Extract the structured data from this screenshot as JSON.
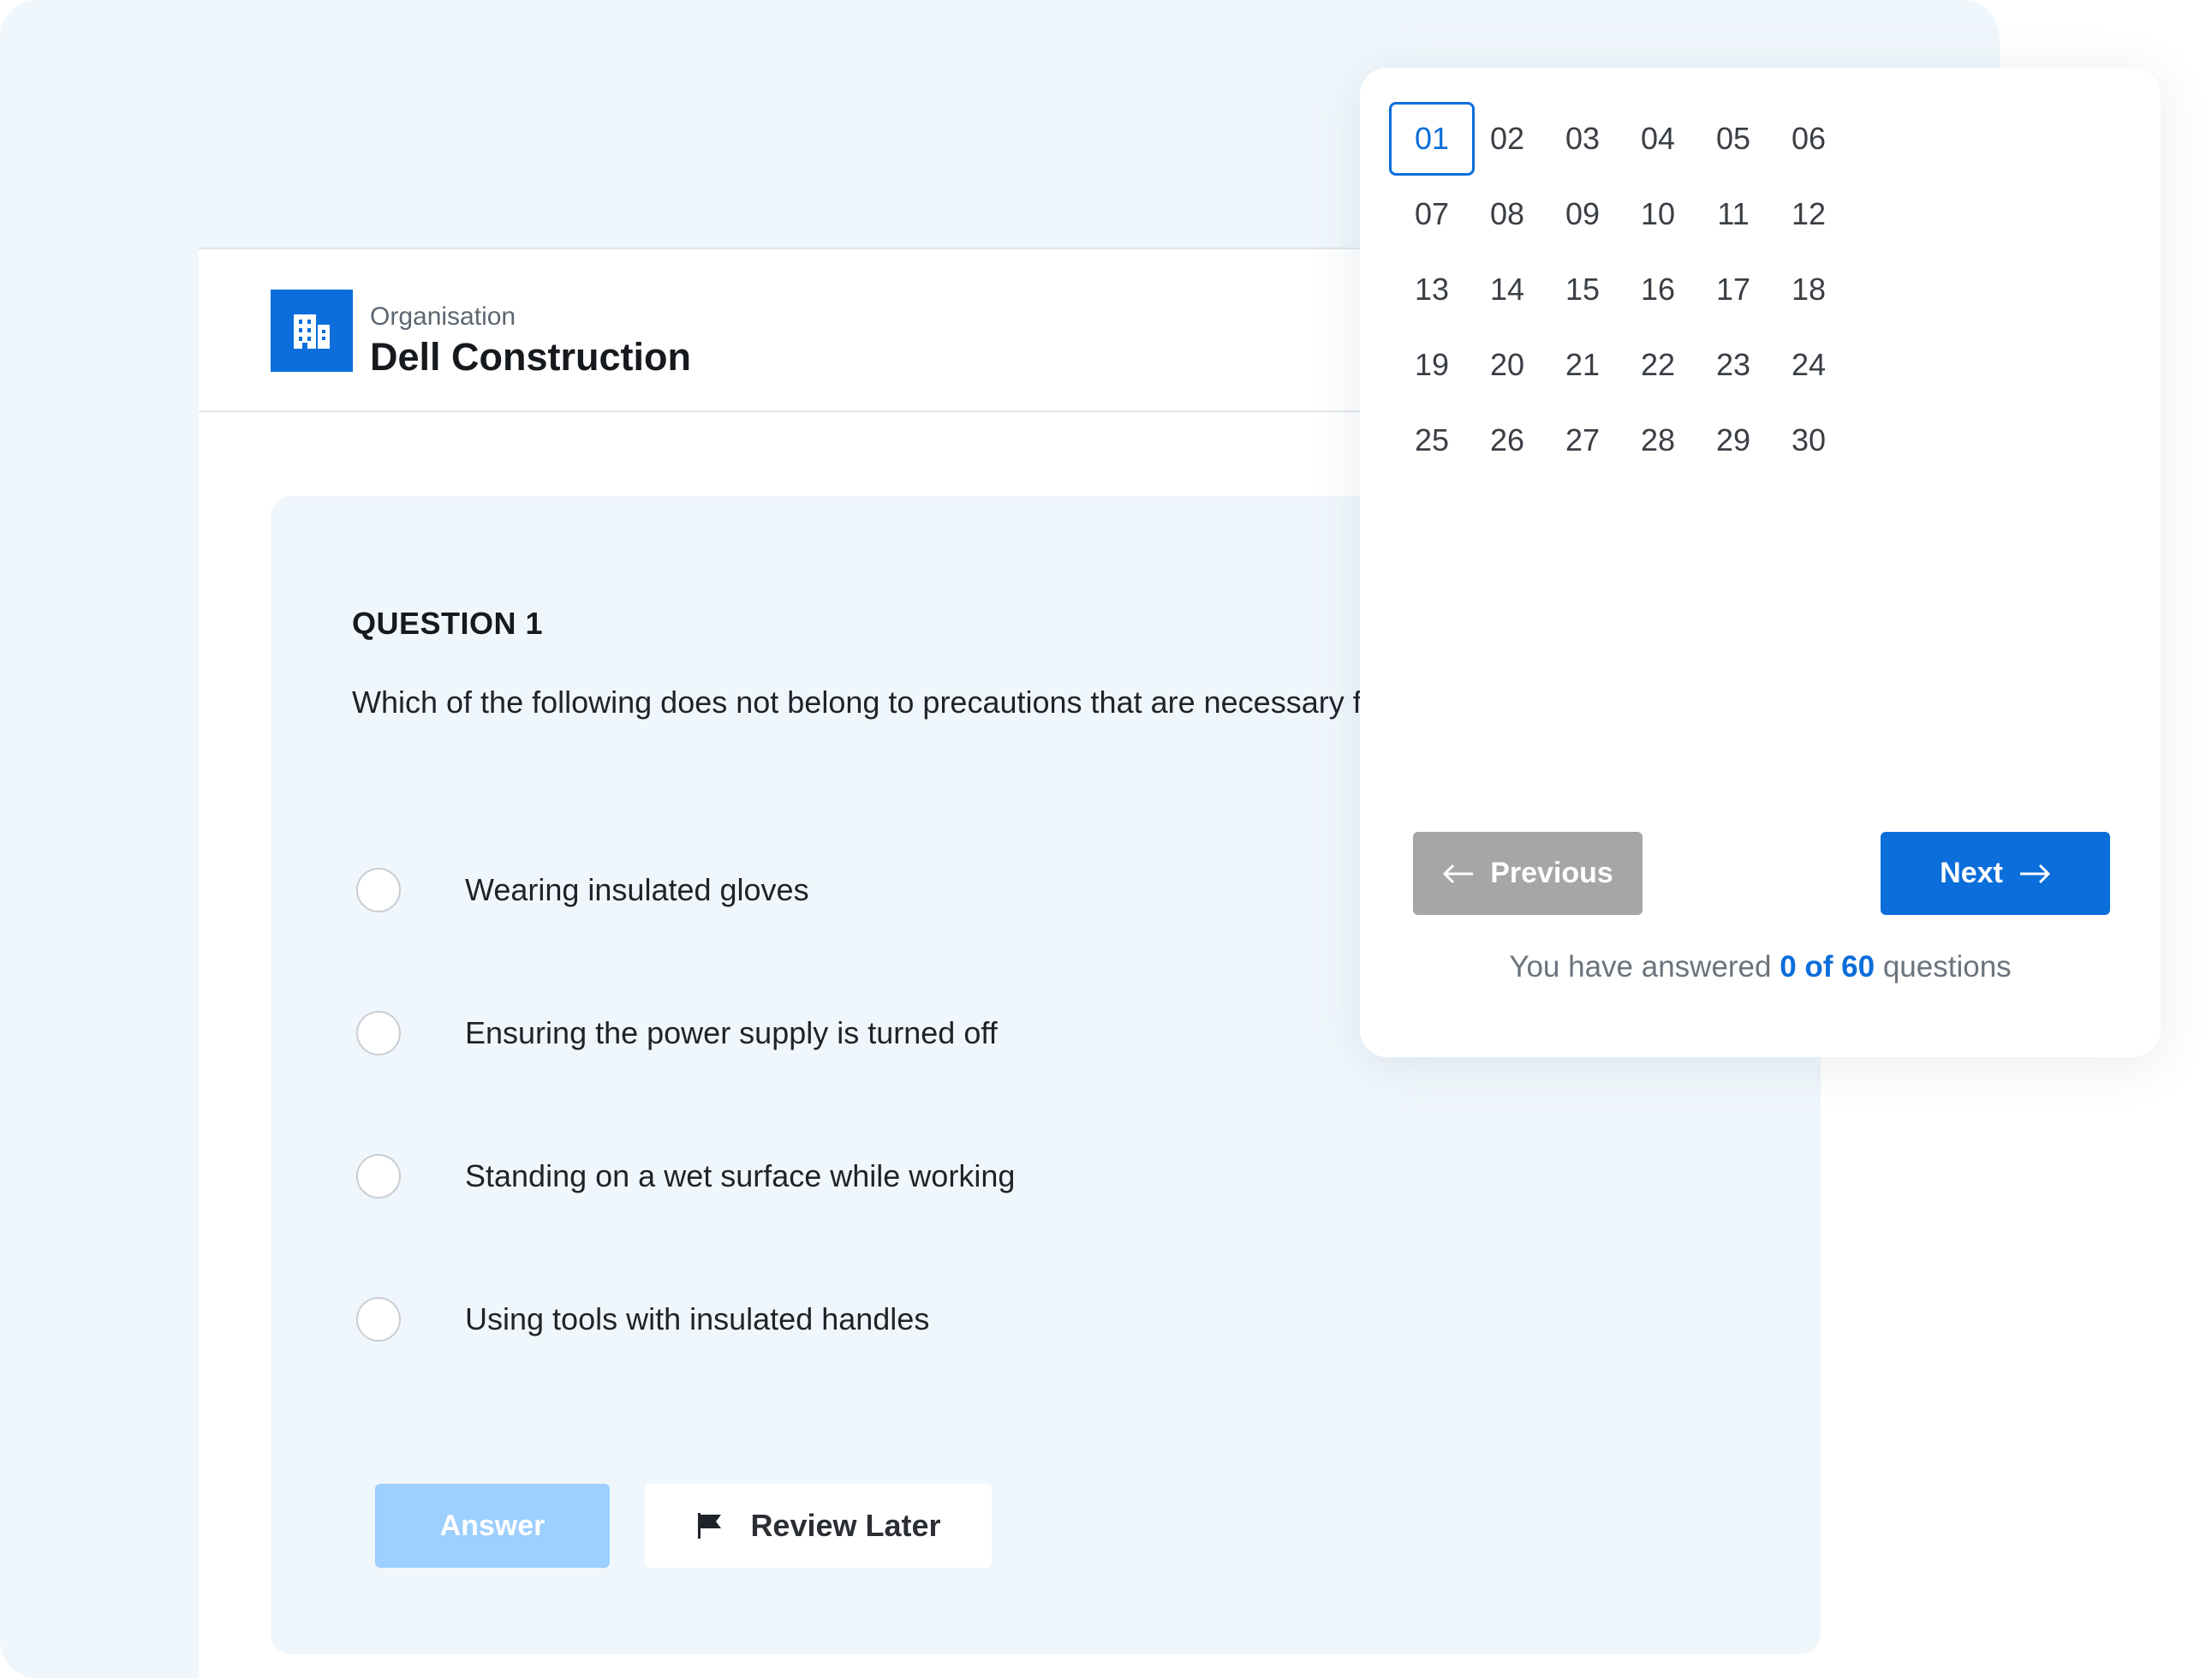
{
  "organisation": {
    "kicker": "Organisation",
    "name": "Dell Construction"
  },
  "question": {
    "heading": "QUESTION 1",
    "text": "Which of the following does not belong to  precautions that are necessary for electrical work?",
    "options": [
      "Wearing insulated gloves",
      "Ensuring the power supply is turned off",
      "Standing on a wet surface while working",
      "Using tools with insulated handles"
    ]
  },
  "actions": {
    "answer_label": "Answer",
    "review_label": "Review Later"
  },
  "navigator": {
    "numbers": [
      "01",
      "02",
      "03",
      "04",
      "05",
      "06",
      "07",
      "08",
      "09",
      "10",
      "11",
      "12",
      "13",
      "14",
      "15",
      "16",
      "17",
      "18",
      "19",
      "20",
      "21",
      "22",
      "23",
      "24",
      "25",
      "26",
      "27",
      "28",
      "29",
      "30"
    ],
    "current": "01",
    "previous_label": "Previous",
    "next_label": "Next",
    "progress_prefix": "You have answered ",
    "progress_count": "0 of 60",
    "progress_suffix": " questions"
  },
  "icons": {
    "organisation": "building-icon",
    "review": "flag-icon",
    "previous": "arrow-left-icon",
    "next": "arrow-right-icon"
  },
  "colors": {
    "accent": "#0b6edb",
    "panel": "#f0f7fc",
    "disabled_answer": "#9dcfff",
    "disabled_previous": "#a6a6a6"
  }
}
